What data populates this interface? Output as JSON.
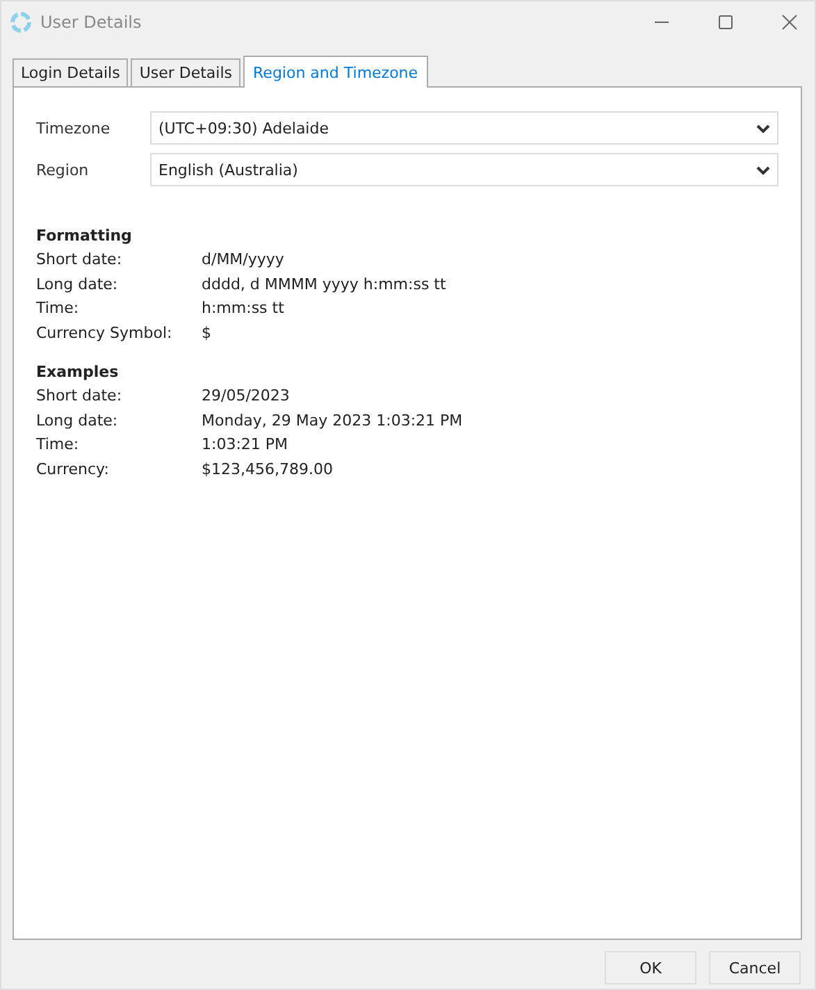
{
  "window": {
    "title": "User Details"
  },
  "tabs": [
    {
      "label": "Login Details",
      "selected": false
    },
    {
      "label": "User Details",
      "selected": false
    },
    {
      "label": "Region and Timezone",
      "selected": true
    }
  ],
  "fields": [
    {
      "label": "Timezone",
      "value": "(UTC+09:30) Adelaide"
    },
    {
      "label": "Region",
      "value": "English (Australia)"
    }
  ],
  "sections": [
    {
      "heading": "Formatting",
      "rows": [
        {
          "label": "Short date:",
          "value": "d/MM/yyyy"
        },
        {
          "label": "Long date:",
          "value": "dddd, d MMMM yyyy h:mm:ss tt"
        },
        {
          "label": "Time:",
          "value": "h:mm:ss tt"
        },
        {
          "label": "Currency Symbol:",
          "value": "$"
        }
      ]
    },
    {
      "heading": "Examples",
      "rows": [
        {
          "label": "Short date:",
          "value": "29/05/2023"
        },
        {
          "label": "Long date:",
          "value": "Monday, 29 May 2023 1:03:21 PM"
        },
        {
          "label": "Time:",
          "value": "1:03:21 PM"
        },
        {
          "label": "Currency:",
          "value": "$123,456,789.00"
        }
      ]
    }
  ],
  "buttons": [
    "OK",
    "Cancel"
  ]
}
